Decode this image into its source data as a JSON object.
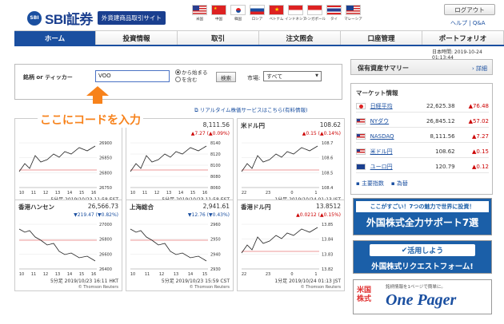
{
  "logo": {
    "mark": "SBI",
    "sub_mark": "GROUP",
    "name": "SBI証券",
    "tagline": "外貨建商品取引サイト"
  },
  "flags": [
    {
      "label": "米国",
      "code": "us"
    },
    {
      "label": "中国",
      "code": "cn"
    },
    {
      "label": "韓国",
      "code": "kr"
    },
    {
      "label": "ロシア",
      "code": "ru"
    },
    {
      "label": "ベトナム",
      "code": "vn"
    },
    {
      "label": "インドネシア",
      "code": "id"
    },
    {
      "label": "シンガポール",
      "code": "sg"
    },
    {
      "label": "タイ",
      "code": "th"
    },
    {
      "label": "マレーシア",
      "code": "my"
    }
  ],
  "header": {
    "logout": "ログアウト",
    "help": "ヘルプ",
    "sep": "|",
    "qa": "Q&A"
  },
  "nav": {
    "items": [
      "ホーム",
      "投資情報",
      "取引",
      "注文照会",
      "口座管理",
      "ポートフォリオ"
    ],
    "active": 0
  },
  "time": "日本時間: 2019-10-24 01:13:44",
  "search": {
    "label": "銘柄 or ティッカー",
    "value": "VOO",
    "radio1": "から始まる",
    "radio2": "を含む",
    "button": "検索",
    "market_label": "市場:",
    "market_value": "すべて"
  },
  "callout": "ここにコードを入力",
  "realtime_link": "リアルタイム株価サービスはこちら(有料情報)",
  "cards": [
    {
      "name": "",
      "price": "",
      "change": "",
      "change_pct": "",
      "footer": "5分足 2019/10/23 11:58 EST",
      "source": "© Thomson Reuters",
      "ticks": [
        "26900",
        "26850",
        "26800",
        "26750"
      ],
      "xticks": [
        "10",
        "11",
        "12",
        "13",
        "14",
        "15",
        "16"
      ],
      "dir": "p"
    },
    {
      "name": "",
      "price": "8,111.56",
      "change": "▲7.27",
      "change_pct": "(▲0.09%)",
      "footer": "5分足 2019/10/23 11:58 EST",
      "source": "© Thomson Reuters",
      "ticks": [
        "8140",
        "8120",
        "8100",
        "8080",
        "8060"
      ],
      "xticks": [
        "10",
        "11",
        "12",
        "13",
        "14",
        "15",
        "16"
      ],
      "dir": "p"
    },
    {
      "name": "米ドル円",
      "price": "108.62",
      "change": "▲0.15",
      "change_pct": "(▲0.14%)",
      "footer": "1分足 2019/10/24 01:13 JST",
      "source": "© Thomson Reuters",
      "ticks": [
        "108.7",
        "108.6",
        "108.5",
        "108.4"
      ],
      "xticks": [
        "22",
        "23",
        "0",
        "1"
      ],
      "dir": "p"
    },
    {
      "name": "香港ハンセン",
      "price": "26,566.73",
      "change": "▼219.47",
      "change_pct": "(▼0.82%)",
      "footer": "5分足 2019/10/23 16:11 HKT",
      "source": "© Thomson Reuters",
      "ticks": [
        "27000",
        "26800",
        "26600",
        "26400"
      ],
      "xticks": [
        "10",
        "11",
        "12",
        "13",
        "14",
        "15",
        "16"
      ],
      "dir": "m"
    },
    {
      "name": "上海総合",
      "price": "2,941.61",
      "change": "▼12.76",
      "change_pct": "(▼0.43%)",
      "footer": "5分足 2019/10/23 15:59 CST",
      "source": "© Thomson Reuters",
      "ticks": [
        "2960",
        "2950",
        "2940",
        "2930"
      ],
      "xticks": [
        "10",
        "11",
        "12",
        "13",
        "14",
        "15"
      ],
      "dir": "m"
    },
    {
      "name": "香港ドル円",
      "price": "13.8512",
      "change": "▲0.0212",
      "change_pct": "(▲0.15%)",
      "footer": "1分足 2019/10/24 01:13 JST",
      "source": "© Thomson Reuters",
      "ticks": [
        "13.85",
        "13.84",
        "13.83",
        "13.82"
      ],
      "xticks": [
        "22",
        "23",
        "0",
        "1"
      ],
      "dir": "p"
    }
  ],
  "holdings": {
    "title": "保有資産サマリー",
    "detail": "詳細"
  },
  "market": {
    "title": "マーケット情報",
    "rows": [
      {
        "name": "日経平均",
        "value": "22,625.38",
        "change": "▲76.48",
        "flag": "jp"
      },
      {
        "name": "NYダウ",
        "value": "26,845.12",
        "change": "▲57.02",
        "flag": "us"
      },
      {
        "name": "NASDAQ",
        "value": "8,111.56",
        "change": "▲7.27",
        "flag": "us"
      },
      {
        "name": "米ドル円",
        "value": "108.62",
        "change": "▲0.15",
        "flag": "us"
      },
      {
        "name": "ユーロ円",
        "value": "120.79",
        "change": "▲0.12",
        "flag": "eu"
      }
    ],
    "link1": "主要指数",
    "link2": "為替"
  },
  "banners": {
    "b1_top": "ここがすごい！7つの魅力で世界に投資！",
    "b1_main": "外国株式全力サポート7選",
    "b2_top": "活用しよう",
    "b2_main": "外国株式リクエストフォーム!",
    "b3_kanji": "米国株式",
    "b3_sub": "銘柄情報を1ページで簡単に。",
    "b3_main": "One Pager"
  }
}
